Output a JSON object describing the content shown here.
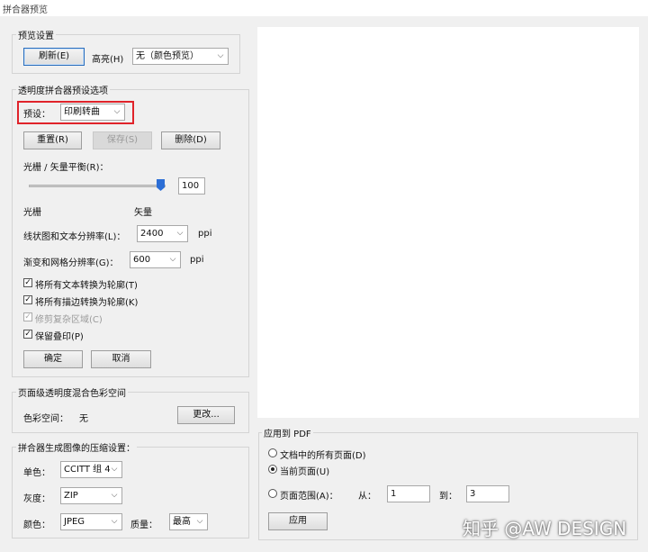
{
  "window": {
    "title": "拼合器预览"
  },
  "preview_settings": {
    "title": "预览设置",
    "refresh_label": "刷新(E)",
    "highlight_label": "高亮(H)",
    "highlight_value": "无（颜色预览）"
  },
  "presets": {
    "title": "透明度拼合器预设选项",
    "preset_label": "预设：",
    "preset_value": "印刷转曲",
    "reset_label": "重置(R)",
    "save_label": "保存(S)",
    "delete_label": "删除(D)",
    "balance_label": "光栅 / 矢量平衡(R)：",
    "balance_value": "100",
    "raster_label": "光栅",
    "vector_label": "矢量",
    "line_res_label": "线状图和文本分辨率(L)：",
    "line_res_value": "2400",
    "gradient_res_label": "渐变和网格分辨率(G)：",
    "gradient_res_value": "600",
    "ppi": "ppi",
    "cb_text_outline": "将所有文本转换为轮廓(T)",
    "cb_stroke_outline": "将所有描边转换为轮廓(K)",
    "cb_clip_complex": "修剪复杂区域(C)",
    "cb_overprint": "保留叠印(P)",
    "ok_label": "确定",
    "cancel_label": "取消"
  },
  "blend_space": {
    "title": "页面级透明度混合色彩空间",
    "label": "色彩空间：",
    "value": "无",
    "change_label": "更改..."
  },
  "compression": {
    "title": "拼合器生成图像的压缩设置：",
    "mono_label": "单色：",
    "mono_value": "CCITT 组 4",
    "gray_label": "灰度：",
    "gray_value": "ZIP",
    "color_label": "颜色：",
    "color_value": "JPEG",
    "quality_label": "质量：",
    "quality_value": "最高"
  },
  "apply_pdf": {
    "title": "应用到 PDF",
    "all_pages": "文档中的所有页面(D)",
    "current_page": "当前页面(U)",
    "page_range": "页面范围(A)：",
    "from_label": "从：",
    "from_value": "1",
    "to_label": "到：",
    "to_value": "3",
    "apply_label": "应用"
  },
  "watermark": "知乎 @AW DESIGN"
}
